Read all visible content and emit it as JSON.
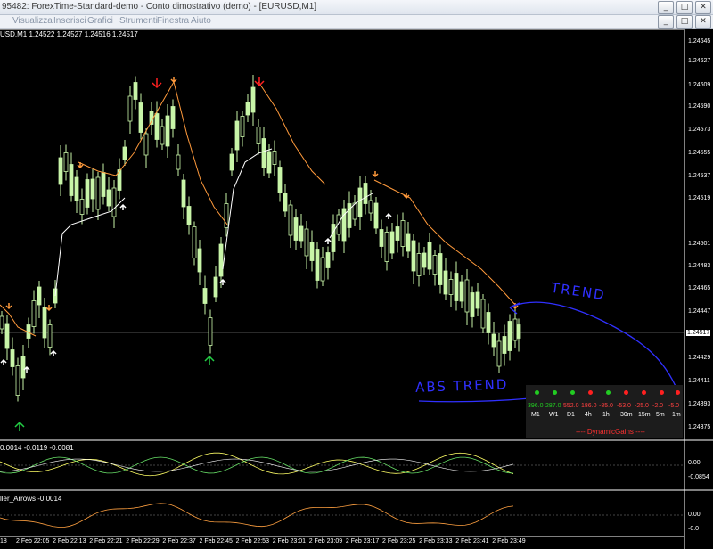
{
  "window": {
    "title": "95482: ForexTime-Standard-demo - Conto dimostrativo (demo) - [EURUSD,M1]",
    "buttons": [
      "_",
      "□",
      "✕"
    ]
  },
  "menu": {
    "items": [
      "Visualizza",
      "Inserisci",
      "Grafici",
      "Strumenti",
      "Finestra",
      "Aiuto"
    ],
    "mdi_buttons": [
      "_",
      "□",
      "✕"
    ]
  },
  "chart": {
    "symbol_line": "USD,M1  1.24522 1.24527 1.24516 1.24517",
    "price_labels": [
      "1.24645",
      "1.24627",
      "1.24609",
      "1.24590",
      "1.24573",
      "1.24555",
      "1.24537",
      "1.24519",
      "1.24517",
      "1.24501",
      "1.24483",
      "1.24465",
      "1.24447",
      "1.24429",
      "1.24411",
      "1.24393",
      "1.24375"
    ],
    "current_price": "1.24517",
    "sub1_label": "0.0014 -0.0119 -0.0081",
    "sub1_levels": [
      "0.00",
      "-0.0854"
    ],
    "sub2_label": "ller_Arrows -0.0014",
    "sub2_levels": [
      "0.00",
      "-0.0"
    ],
    "time_labels": [
      "18",
      "2 Feb 22:05",
      "2 Feb 22:13",
      "2 Feb 22:21",
      "2 Feb 22:29",
      "2 Feb 22:37",
      "2 Feb 22:45",
      "2 Feb 22:53",
      "2 Feb 23:01",
      "2 Feb 23:09",
      "2 Feb 23:17",
      "2 Feb 23:25",
      "2 Feb 23:33",
      "2 Feb 23:41",
      "2 Feb 23:49"
    ]
  },
  "dynamic_gains": {
    "title": "---- DynamicGains ----",
    "timeframes": [
      "M1",
      "W1",
      "D1",
      "4h",
      "1h",
      "30m",
      "15m",
      "5m",
      "1m"
    ],
    "values": [
      "396.0",
      "287.0",
      "552.0",
      "186.0",
      "-85.0",
      "-53.0",
      "-25.0",
      "-2.0",
      "-5.0"
    ],
    "dot_colors": [
      "#22cc22",
      "#22cc22",
      "#22cc22",
      "#ff2020",
      "#22cc22",
      "#ff2020",
      "#ff2020",
      "#ff2020",
      "#ff2020"
    ],
    "value_colors": [
      "#22cc22",
      "#22cc22",
      "#ff4040",
      "#ff4040",
      "#ff4040",
      "#ff4040",
      "#ff4040",
      "#ff4040",
      "#ff4040"
    ]
  },
  "annotations": {
    "trend": "TREND",
    "abs_trend": "ABS TREND",
    "ink_color": "#3030ff"
  },
  "colors": {
    "candle": "#c8f5a8",
    "signal_line_up": "#ffffff",
    "signal_line_down": "#ff9a3c",
    "arrow_up": "#ffffff",
    "arrow_up_big": "#22cc44",
    "arrow_down_big": "#ff2020",
    "arrow_small_down": "#ff9a3c"
  }
}
